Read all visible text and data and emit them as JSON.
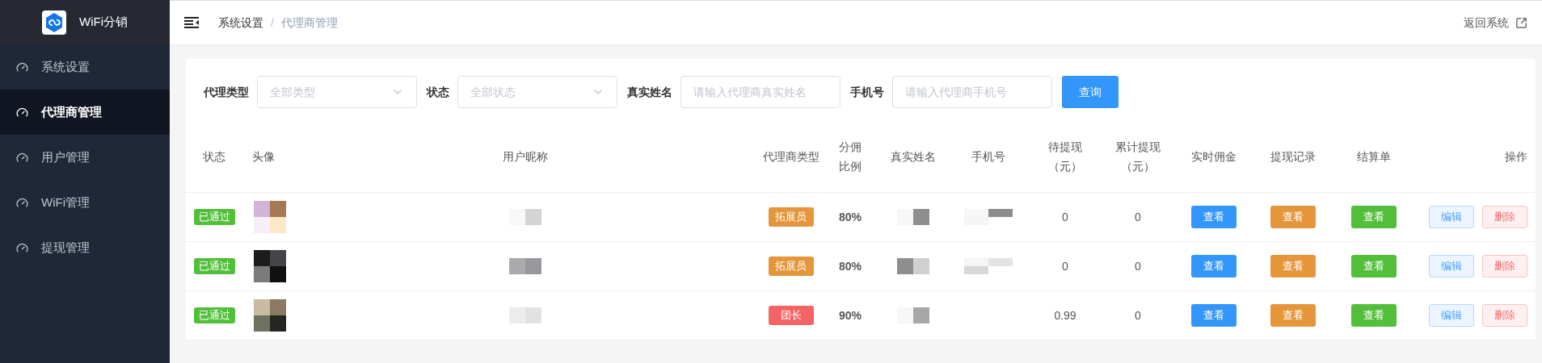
{
  "sidebar": {
    "brand": "WiFi分销",
    "items": [
      {
        "label": "系统设置",
        "selected": false
      },
      {
        "label": "代理商管理",
        "selected": true
      },
      {
        "label": "用户管理",
        "selected": false
      },
      {
        "label": "WiFi管理",
        "selected": false
      },
      {
        "label": "提现管理",
        "selected": false
      }
    ]
  },
  "header": {
    "breadcrumb": [
      "系统设置",
      "代理商管理"
    ],
    "separator": "/",
    "back_link": "返回系统"
  },
  "filters": [
    {
      "kind": "select",
      "label": "代理类型",
      "placeholder": "全部类型"
    },
    {
      "kind": "select",
      "label": "状态",
      "placeholder": "全部状态"
    },
    {
      "kind": "input",
      "label": "真实姓名",
      "placeholder": "请输入代理商真实姓名"
    },
    {
      "kind": "input",
      "label": "手机号",
      "placeholder": "请输入代理商手机号"
    }
  ],
  "search_button": "查询",
  "table": {
    "columns": [
      "状态",
      "头像",
      "用户昵称",
      "代理商类型",
      "分佣比例",
      "真实姓名",
      "手机号",
      "待提现（元）",
      "累计提现（元）",
      "实时佣金",
      "提现记录",
      "结算单",
      "操作"
    ],
    "rows": [
      {
        "status": "已通过",
        "agent_type": {
          "label": "拓展员",
          "color": "#e6963a"
        },
        "ratio": "80%",
        "pending": "0",
        "total": "0",
        "commission": "查看",
        "records": "查看",
        "statement": "查看",
        "edit": "编辑",
        "delete": "删除"
      },
      {
        "status": "已通过",
        "agent_type": {
          "label": "拓展员",
          "color": "#e6963a"
        },
        "ratio": "80%",
        "pending": "0",
        "total": "0",
        "commission": "查看",
        "records": "查看",
        "statement": "查看",
        "edit": "编辑",
        "delete": "删除"
      },
      {
        "status": "已通过",
        "agent_type": {
          "label": "团长",
          "color": "#f46464"
        },
        "ratio": "90%",
        "pending": "0.99",
        "total": "0",
        "commission": "查看",
        "records": "查看",
        "statement": "查看",
        "edit": "编辑",
        "delete": "删除"
      }
    ]
  }
}
